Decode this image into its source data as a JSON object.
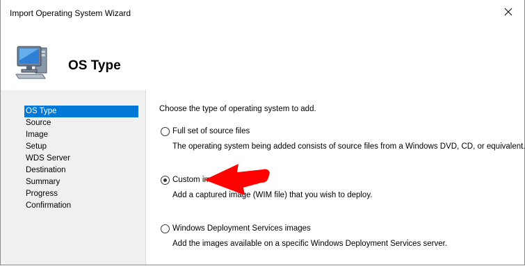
{
  "window": {
    "title": "Import Operating System Wizard",
    "close_glyph": "✕"
  },
  "header": {
    "title": "OS Type",
    "icon": "computer-icon"
  },
  "sidebar": {
    "steps": [
      {
        "label": "OS Type",
        "active": true
      },
      {
        "label": "Source",
        "active": false
      },
      {
        "label": "Image",
        "active": false
      },
      {
        "label": "Setup",
        "active": false
      },
      {
        "label": "WDS Server",
        "active": false
      },
      {
        "label": "Destination",
        "active": false
      },
      {
        "label": "Summary",
        "active": false
      },
      {
        "label": "Progress",
        "active": false
      },
      {
        "label": "Confirmation",
        "active": false
      }
    ]
  },
  "main": {
    "intro": "Choose the type of operating system to add.",
    "options": [
      {
        "label": "Full set of source files",
        "description": "The operating system being added consists of source files from a Windows DVD, CD, or equivalent.",
        "selected": false
      },
      {
        "label": "Custom image file",
        "description": "Add a captured image (WIM file) that you wish to deploy.",
        "selected": true
      },
      {
        "label": "Windows Deployment Services images",
        "description": "Add the images available on a specific Windows Deployment Services server.",
        "selected": false
      }
    ]
  },
  "colors": {
    "selection_highlight": "#0078d7",
    "sidebar_bg": "#f0f0f0",
    "annotation_arrow": "#ff0000"
  },
  "annotation": {
    "icon": "red-arrow-icon",
    "points_to": "Custom image file"
  }
}
